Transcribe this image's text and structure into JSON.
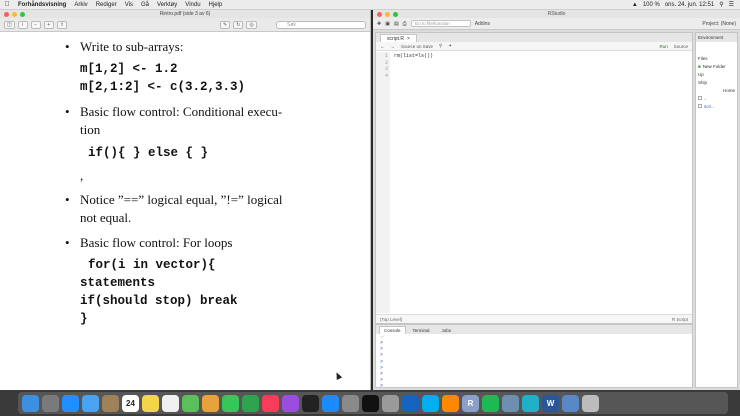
{
  "menubar": {
    "app": "Forhåndsvisning",
    "items": [
      "Arkiv",
      "Rediger",
      "Vis",
      "Gå",
      "Verktøy",
      "Vindu",
      "Hjelp"
    ],
    "battery": "100 %",
    "clock": "ons. 24. jun.  12:51"
  },
  "preview": {
    "title": "Rintro.pdf (side 3 av 6)",
    "search_placeholder": "Søk"
  },
  "slide": {
    "bullet1": "Write to sub-arrays:",
    "code1": "m[1,2] <- 1.2",
    "code2": "m[2,1:2] <- c(3.2,3.3)",
    "bullet2_line1": "Basic flow control: Conditional execu-",
    "bullet2_line2": "tion",
    "code3": "if(){ } else { }",
    "comma": ",",
    "bullet3_line1": "Notice ”==” logical equal, ”!=” logical",
    "bullet3_line2": "not equal.",
    "bullet4": "Basic flow control: For loops",
    "code4": "for(i in vector){",
    "code5": "statements",
    "code6": "if(should stop) break",
    "code7": "}"
  },
  "rstudio": {
    "title": "RStudio",
    "goto_placeholder": "Go to file/function",
    "addins": "Addins",
    "project": "Project: (None)",
    "editor_tab": "script.R",
    "source_on_save": "Source on Save",
    "run": "Run",
    "source": "Source",
    "line_numbers": [
      "1",
      "2",
      "3",
      "4"
    ],
    "code_line1": "rm(list=ls())",
    "status_left": "(Top Level)",
    "status_right": "R Script",
    "console_tabs": [
      "Console",
      "Terminal",
      "Jobs"
    ],
    "console_path": "~/",
    "prompts": [
      ">",
      ">",
      ">",
      ">",
      ">",
      ">",
      ">",
      ">"
    ],
    "env_tab": "Environment",
    "files_label": "Files",
    "new_folder": "New Folder",
    "files_rows": [
      "Up",
      "Ship",
      "Home",
      "..",
      "scri..."
    ]
  },
  "dock": {
    "apps": [
      "finder-icon",
      "launchpad-icon",
      "safari-icon",
      "mail-icon",
      "contacts-icon",
      "calendar-icon",
      "notes-icon",
      "reminders-icon",
      "maps-icon",
      "photos-icon",
      "messages-icon",
      "facetime-icon",
      "music-icon",
      "podcasts-icon",
      "tv-icon",
      "app-store-icon",
      "system-preferences-icon",
      "terminal-icon",
      "script-editor-icon",
      "outlook-icon",
      "skype-icon",
      "vlc-icon",
      "r-icon",
      "spotify-icon",
      "preview-icon",
      "webstorm-icon",
      "word-icon",
      "downloads-icon",
      "trash-icon"
    ],
    "calendar_day": "24",
    "r_letter": "R",
    "w_letter": "W"
  }
}
